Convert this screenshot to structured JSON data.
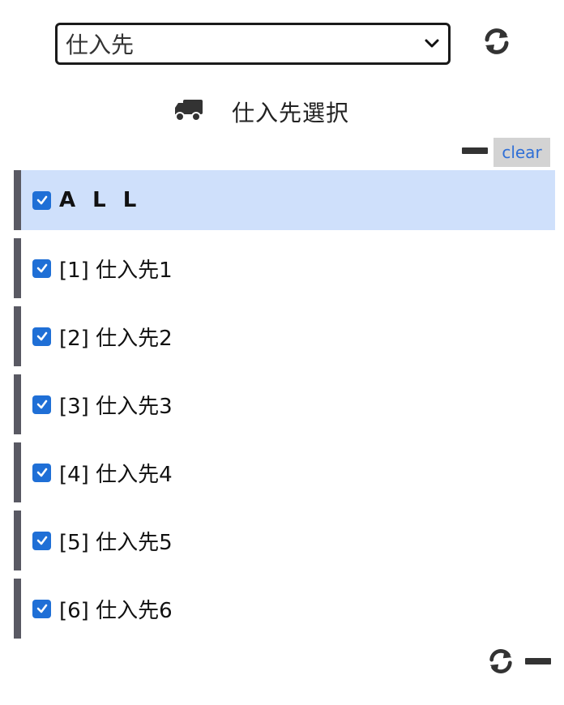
{
  "filter": {
    "select_value": "仕入先",
    "refresh_icon": "refresh-icon"
  },
  "header": {
    "icon": "truck-icon",
    "title": "仕入先選択"
  },
  "controls": {
    "collapse_icon": "minus-icon",
    "clear_label": "clear"
  },
  "list": {
    "all_label": "A L L",
    "items": [
      {
        "label": "[1] 仕入先1",
        "checked": true
      },
      {
        "label": "[2] 仕入先2",
        "checked": true
      },
      {
        "label": "[3] 仕入先3",
        "checked": true
      },
      {
        "label": "[4] 仕入先4",
        "checked": true
      },
      {
        "label": "[5] 仕入先5",
        "checked": true
      },
      {
        "label": "[6] 仕入先6",
        "checked": true
      }
    ]
  },
  "colors": {
    "accent": "#1f6fd6",
    "selected_row": "#cfe0fb",
    "row_border": "#595963",
    "clear_bg": "#d3d3d3",
    "clear_text": "#2f6fd6"
  }
}
